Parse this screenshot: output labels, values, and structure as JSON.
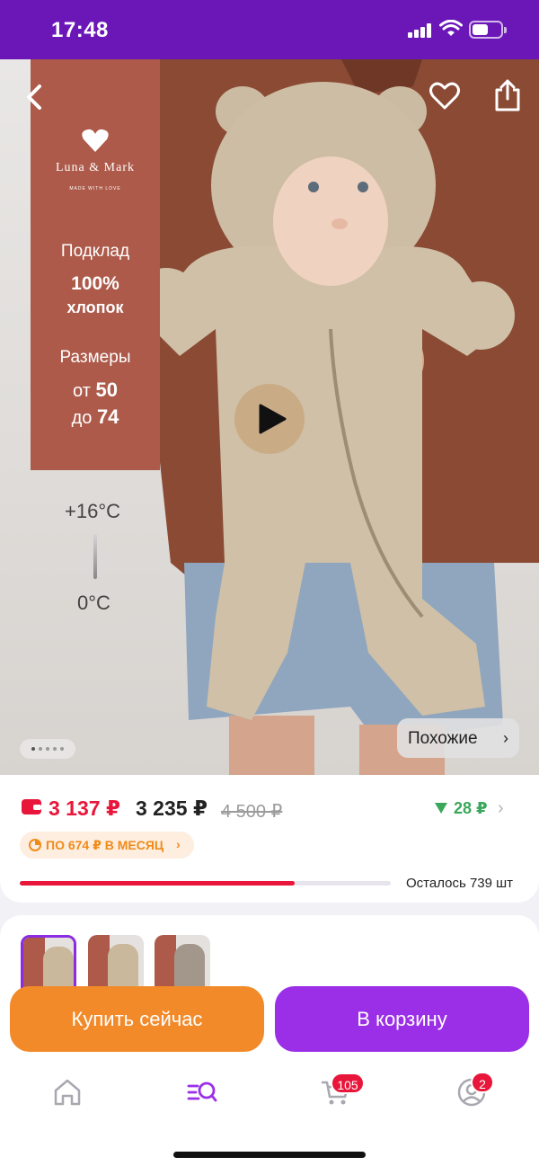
{
  "status_bar": {
    "time": "17:48"
  },
  "hero": {
    "brand": {
      "name": "Luna & Mark",
      "tagline": "MADE WITH LOVE"
    },
    "panel": {
      "lining_label": "Подклад",
      "lining_value": "100%",
      "lining_material": "хлопок",
      "sizes_label": "Размеры",
      "size_from_word": "от",
      "size_from": "50",
      "size_to_word": "до",
      "size_to": "74"
    },
    "temp_high": "+16°C",
    "temp_low": "0°C",
    "similar_label": "Похожие",
    "gallery_count": 5,
    "gallery_active_index": 0
  },
  "price": {
    "wallet_price": "3 137 ₽",
    "regular_price": "3 235 ₽",
    "old_price": "4 500 ₽",
    "price_drop": "28 ₽",
    "installment": "ПО 674 ₽ В МЕСЯЦ",
    "stock_text": "Осталось 739 шт",
    "stock_fraction": 0.74
  },
  "thumbnails": [
    {
      "name": "photo-1",
      "selected": true
    },
    {
      "name": "photo-2",
      "selected": false
    },
    {
      "name": "photo-3",
      "selected": false
    }
  ],
  "actions": {
    "buy_now": "Купить сейчас",
    "add_to_cart": "В корзину"
  },
  "nav": {
    "items": [
      {
        "icon": "home-icon"
      },
      {
        "icon": "catalog-search-icon",
        "active": true
      },
      {
        "icon": "cart-icon",
        "badge": "105"
      },
      {
        "icon": "profile-icon",
        "badge": "2"
      }
    ]
  },
  "colors": {
    "status_bar": "#6b17b8",
    "accent_purple": "#9b2fe8",
    "accent_orange": "#f28a2a",
    "price_red": "#e8163a",
    "drop_green": "#3aa85b",
    "brand_panel": "#ad5a4a"
  }
}
